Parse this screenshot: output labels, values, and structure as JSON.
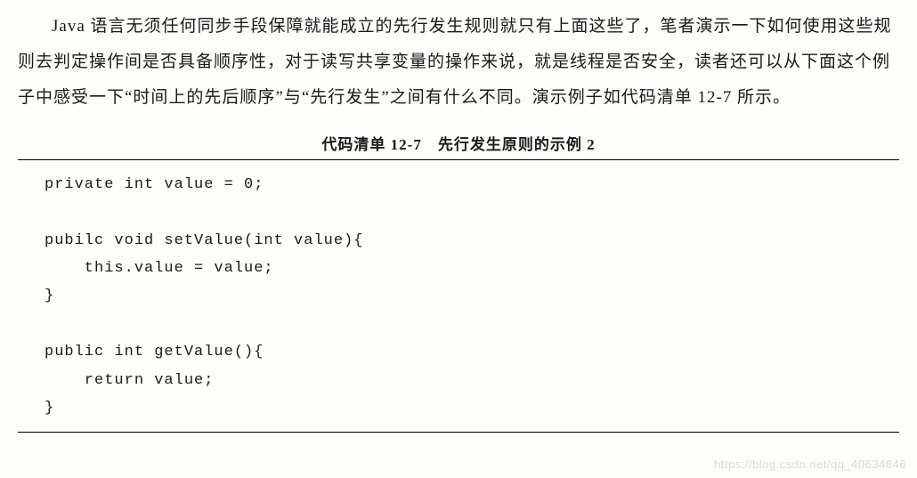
{
  "paragraph": "Java 语言无须任何同步手段保障就能成立的先行发生规则就只有上面这些了，笔者演示一下如何使用这些规则去判定操作间是否具备顺序性，对于读写共享变量的操作来说，就是线程是否安全，读者还可以从下面这个例子中感受一下“时间上的先后顺序”与“先行发生”之间有什么不同。演示例子如代码清单 12-7 所示。",
  "listing_title": "代码清单 12-7　先行发生原则的示例 2",
  "code": "private int value = 0;\n\npubilc void setValue(int value){\n    this.value = value;\n}\n\npublic int getValue(){\n    return value;\n}",
  "watermark": "https://blog.csdn.net/qq_40634846"
}
